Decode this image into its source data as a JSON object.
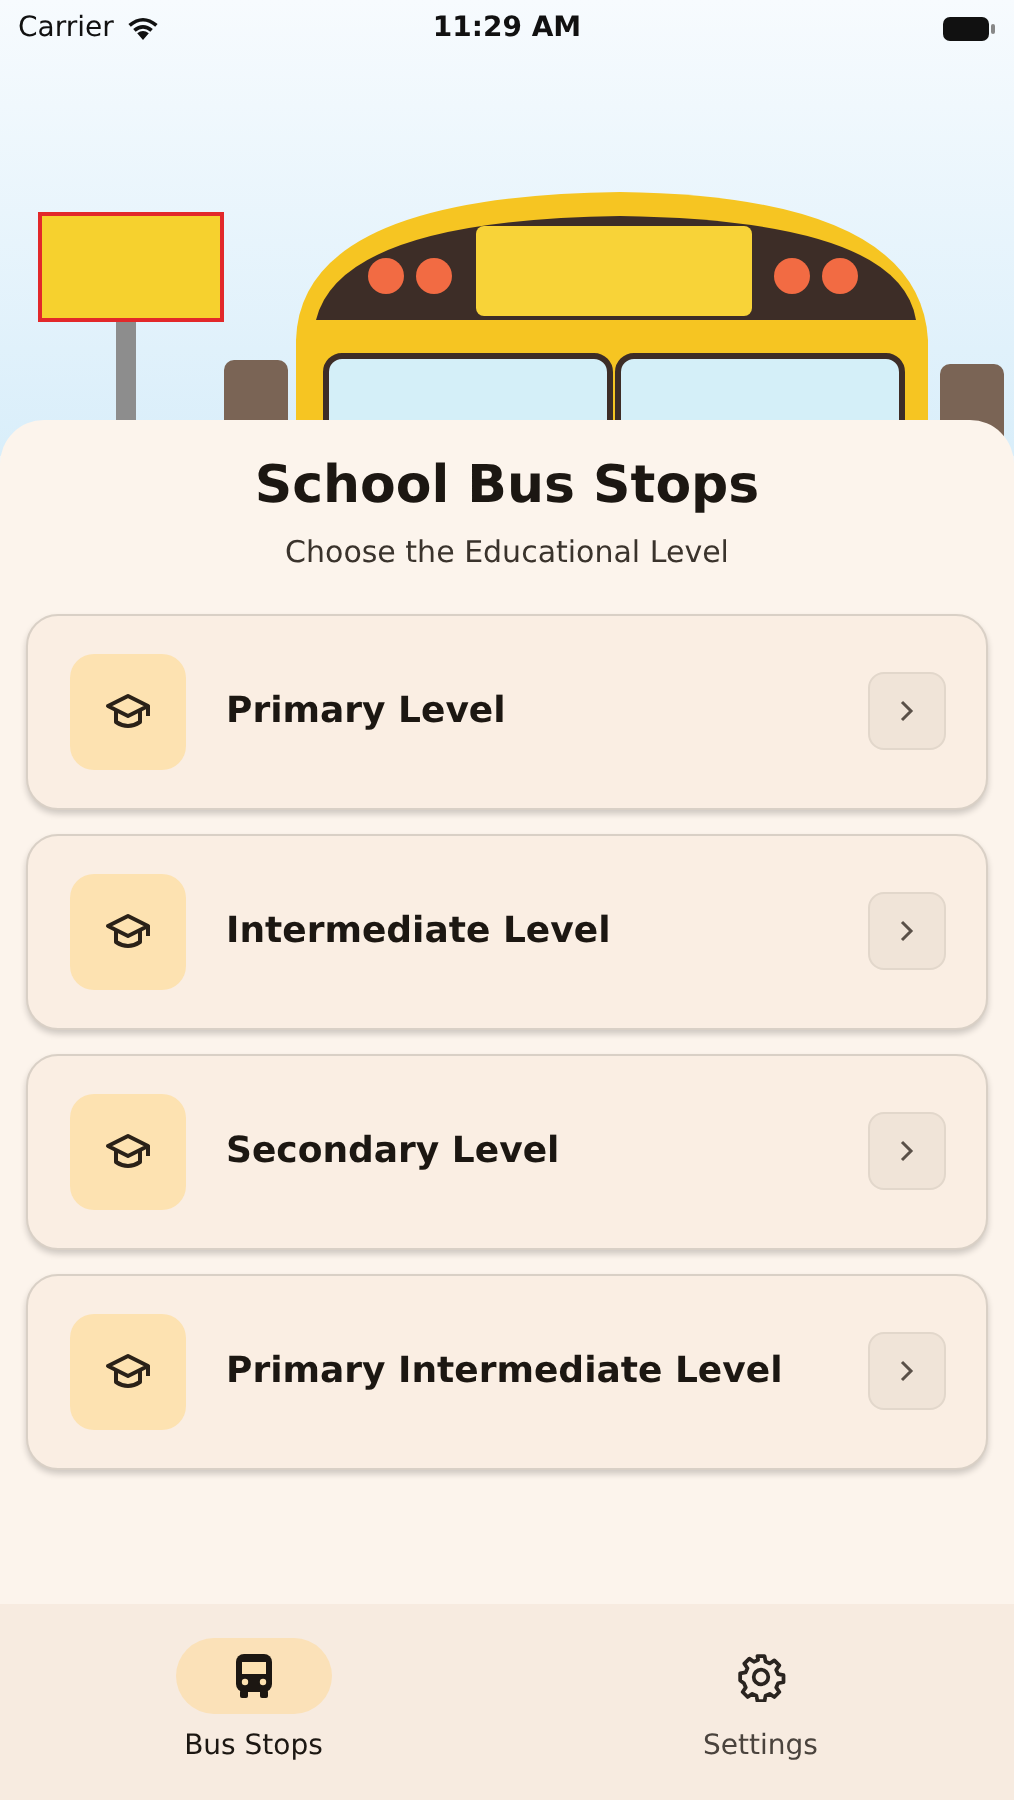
{
  "status_bar": {
    "carrier": "Carrier",
    "time": "11:29 AM"
  },
  "title": "School Bus Stops",
  "subtitle": "Choose the Educational Level",
  "levels": [
    {
      "label": "Primary Level"
    },
    {
      "label": "Intermediate Level"
    },
    {
      "label": "Secondary Level"
    },
    {
      "label": "Primary Intermediate Level"
    }
  ],
  "tab_bar": [
    {
      "label": "Bus Stops",
      "kind": "bus",
      "selected": true
    },
    {
      "label": "Settings",
      "kind": "settings",
      "selected": false
    }
  ]
}
